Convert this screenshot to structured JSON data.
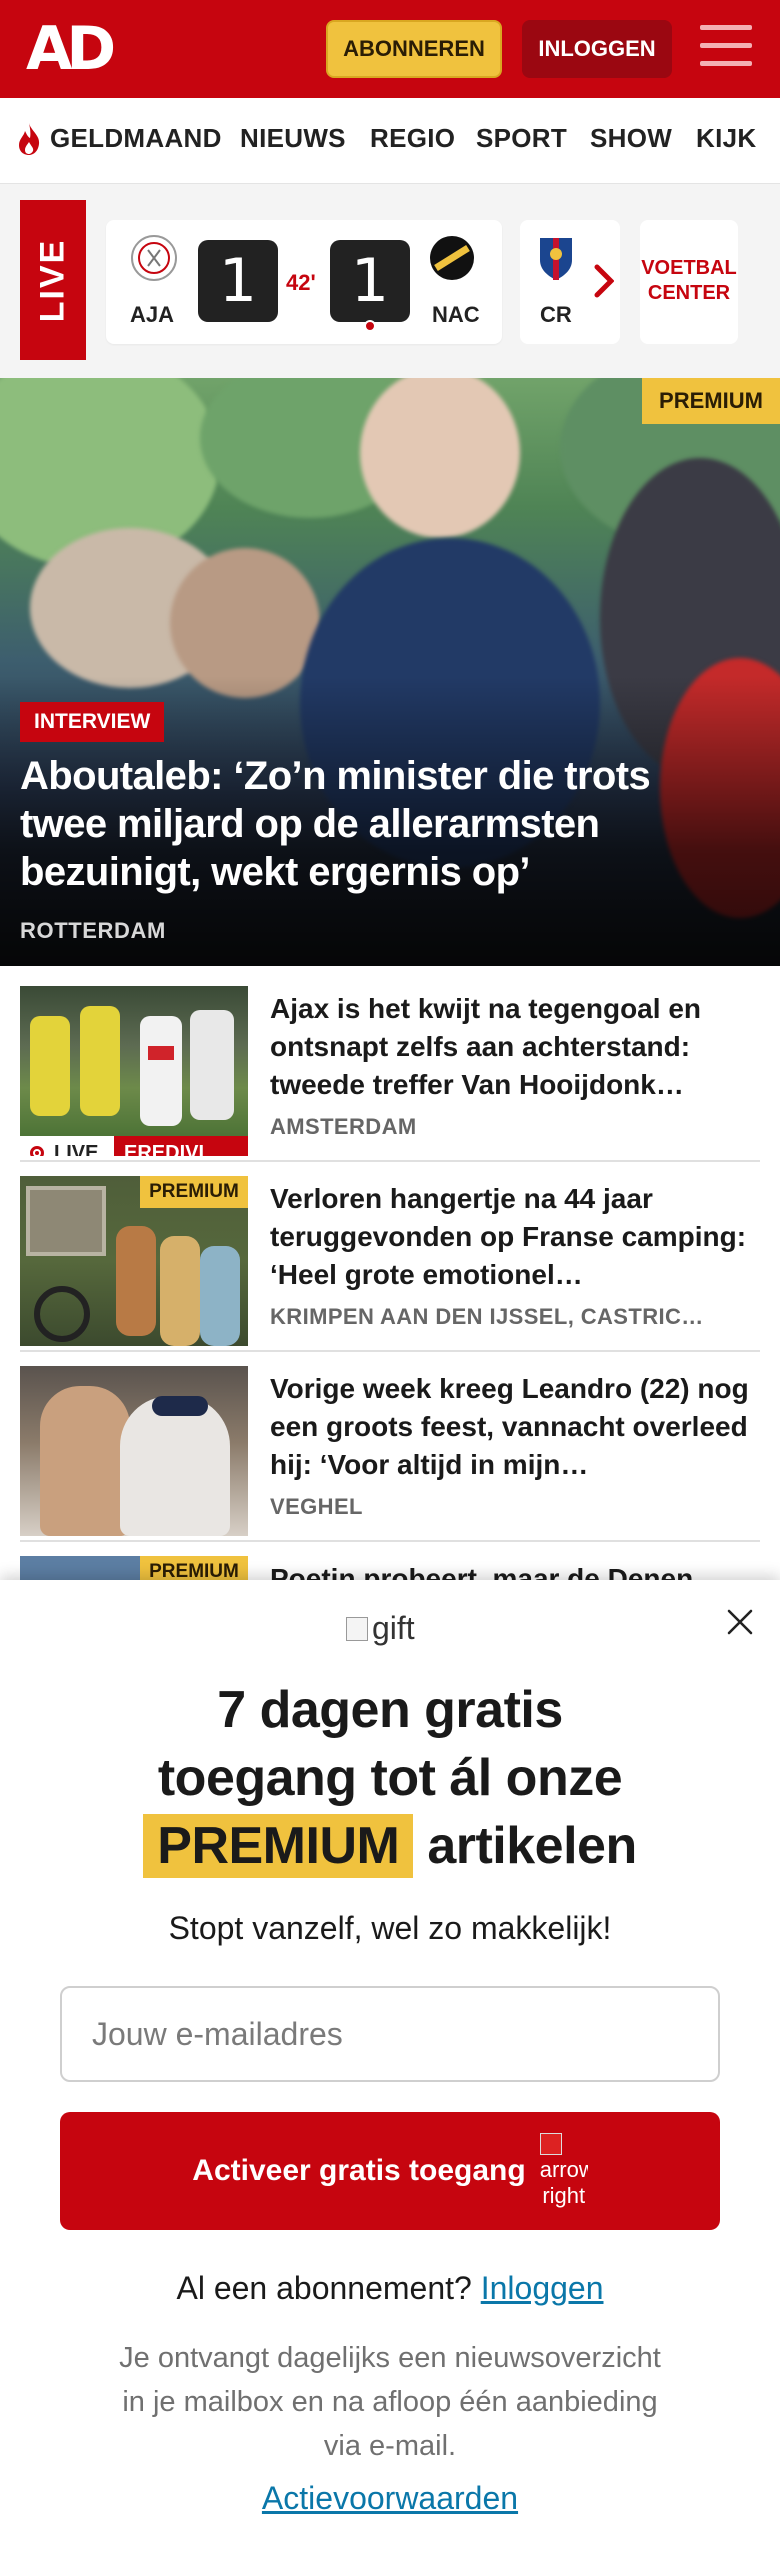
{
  "header": {
    "logo": "AD",
    "subscribe_label": "ABONNEREN",
    "login_label": "INLOGGEN"
  },
  "nav": {
    "items": [
      "GELDMAAND",
      "NIEUWS",
      "REGIO",
      "SPORT",
      "SHOW",
      "KIJK"
    ]
  },
  "live": {
    "tag": "LIVE",
    "match": {
      "home": "AJA",
      "away": "NAC",
      "home_score": "1",
      "away_score": "1",
      "minute": "42'"
    },
    "next_team": "CR",
    "voetbal_center": "VOETBAL CENTER"
  },
  "hero": {
    "badge": "PREMIUM",
    "category": "INTERVIEW",
    "title": "Aboutaleb: ‘Zo’n minister die trots twee miljard op de allerarmsten bezuinigt, wekt ergernis op’",
    "location": "ROTTERDAM"
  },
  "articles": [
    {
      "title": "Ajax is het kwijt na tegengoal en ontsnapt zelfs aan achterstand: tweede treffer Van Hooijdonk…",
      "location": "AMSTERDAM",
      "live_label": "LIVE",
      "category": "EREDIVI…"
    },
    {
      "badge": "PREMIUM",
      "title": "Verloren hangertje na 44 jaar teruggevonden op Franse camping: ‘Heel grote emotionel…",
      "location": "KRIMPEN AAN DEN IJSSEL, CASTRIC…"
    },
    {
      "title": "Vorige week kreeg Leandro (22) nog een groots feest, vannacht overleed hij: ‘Voor altijd in mijn…",
      "location": "VEGHEL"
    },
    {
      "badge": "PREMIUM",
      "title": "Poetin probeert, maar de Denen…"
    }
  ],
  "modal": {
    "gift_alt": "gift",
    "title_line1": "7 dagen gratis",
    "title_line2": "toegang tot ál onze",
    "title_premium": "PREMIUM",
    "title_line3_rest": "artikelen",
    "subtitle": "Stopt vanzelf, wel zo makkelijk!",
    "email_placeholder": "Jouw e-mailadres",
    "cta_label": "Activeer gratis toegang",
    "cta_icon_alt": "arrow right",
    "already_text": "Al een abonnement?",
    "already_link": "Inloggen",
    "note": "Je ontvangt dagelijks een nieuwsoverzicht in je mailbox en na afloop één aanbieding via e-mail.",
    "terms": "Actievoorwaarden"
  },
  "colors": {
    "brand_red": "#c6050f",
    "premium_yellow": "#f0c23e",
    "link_blue": "#0a77a9"
  }
}
